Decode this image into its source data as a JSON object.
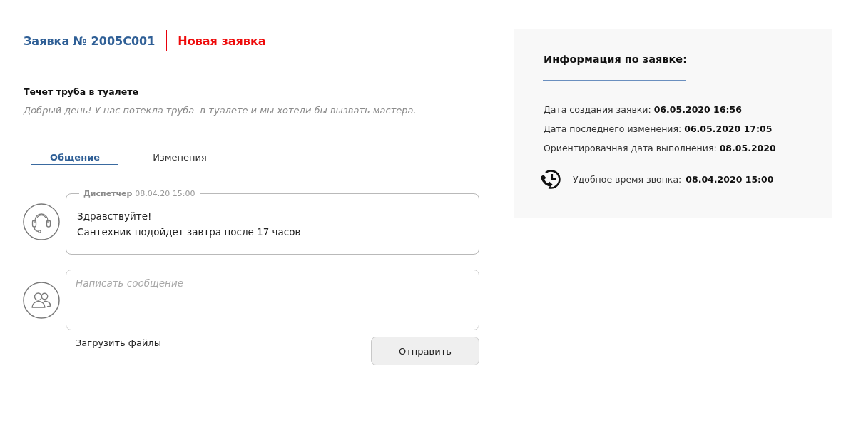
{
  "request": {
    "number_label": "Заявка № 2005C001",
    "status": "Новая заявка"
  },
  "issue": {
    "title": "Течет труба в туалете",
    "description": "Добрый день! У нас потекла труба  в туалете и мы хотели бы вызвать мастера."
  },
  "tabs": [
    {
      "label": "Общение",
      "selected": true
    },
    {
      "label": "Изменения",
      "selected": false
    }
  ],
  "messages": [
    {
      "author": "Диспетчер",
      "time": "08.04.20 15:00",
      "lines": [
        "Здравствуйте!",
        "Сантехник подойдет завтра после 17 часов"
      ]
    }
  ],
  "compose": {
    "placeholder": "Написать сообщение",
    "upload_link": "Загрузить файлы",
    "send_button": "Отправить"
  },
  "info": {
    "title": "Информация по заявке:",
    "rows": [
      {
        "label": "Дата создания заявки:",
        "value": "06.05.2020 16:56"
      },
      {
        "label": "Дата последнего изменения:",
        "value": "06.05.2020 17:05"
      },
      {
        "label": "Ориентировачная дата выполнения:",
        "value": "08.05.2020"
      }
    ],
    "call_time": {
      "label": "Удобное время звонка:",
      "value": "08.04.2020 15:00"
    }
  }
}
